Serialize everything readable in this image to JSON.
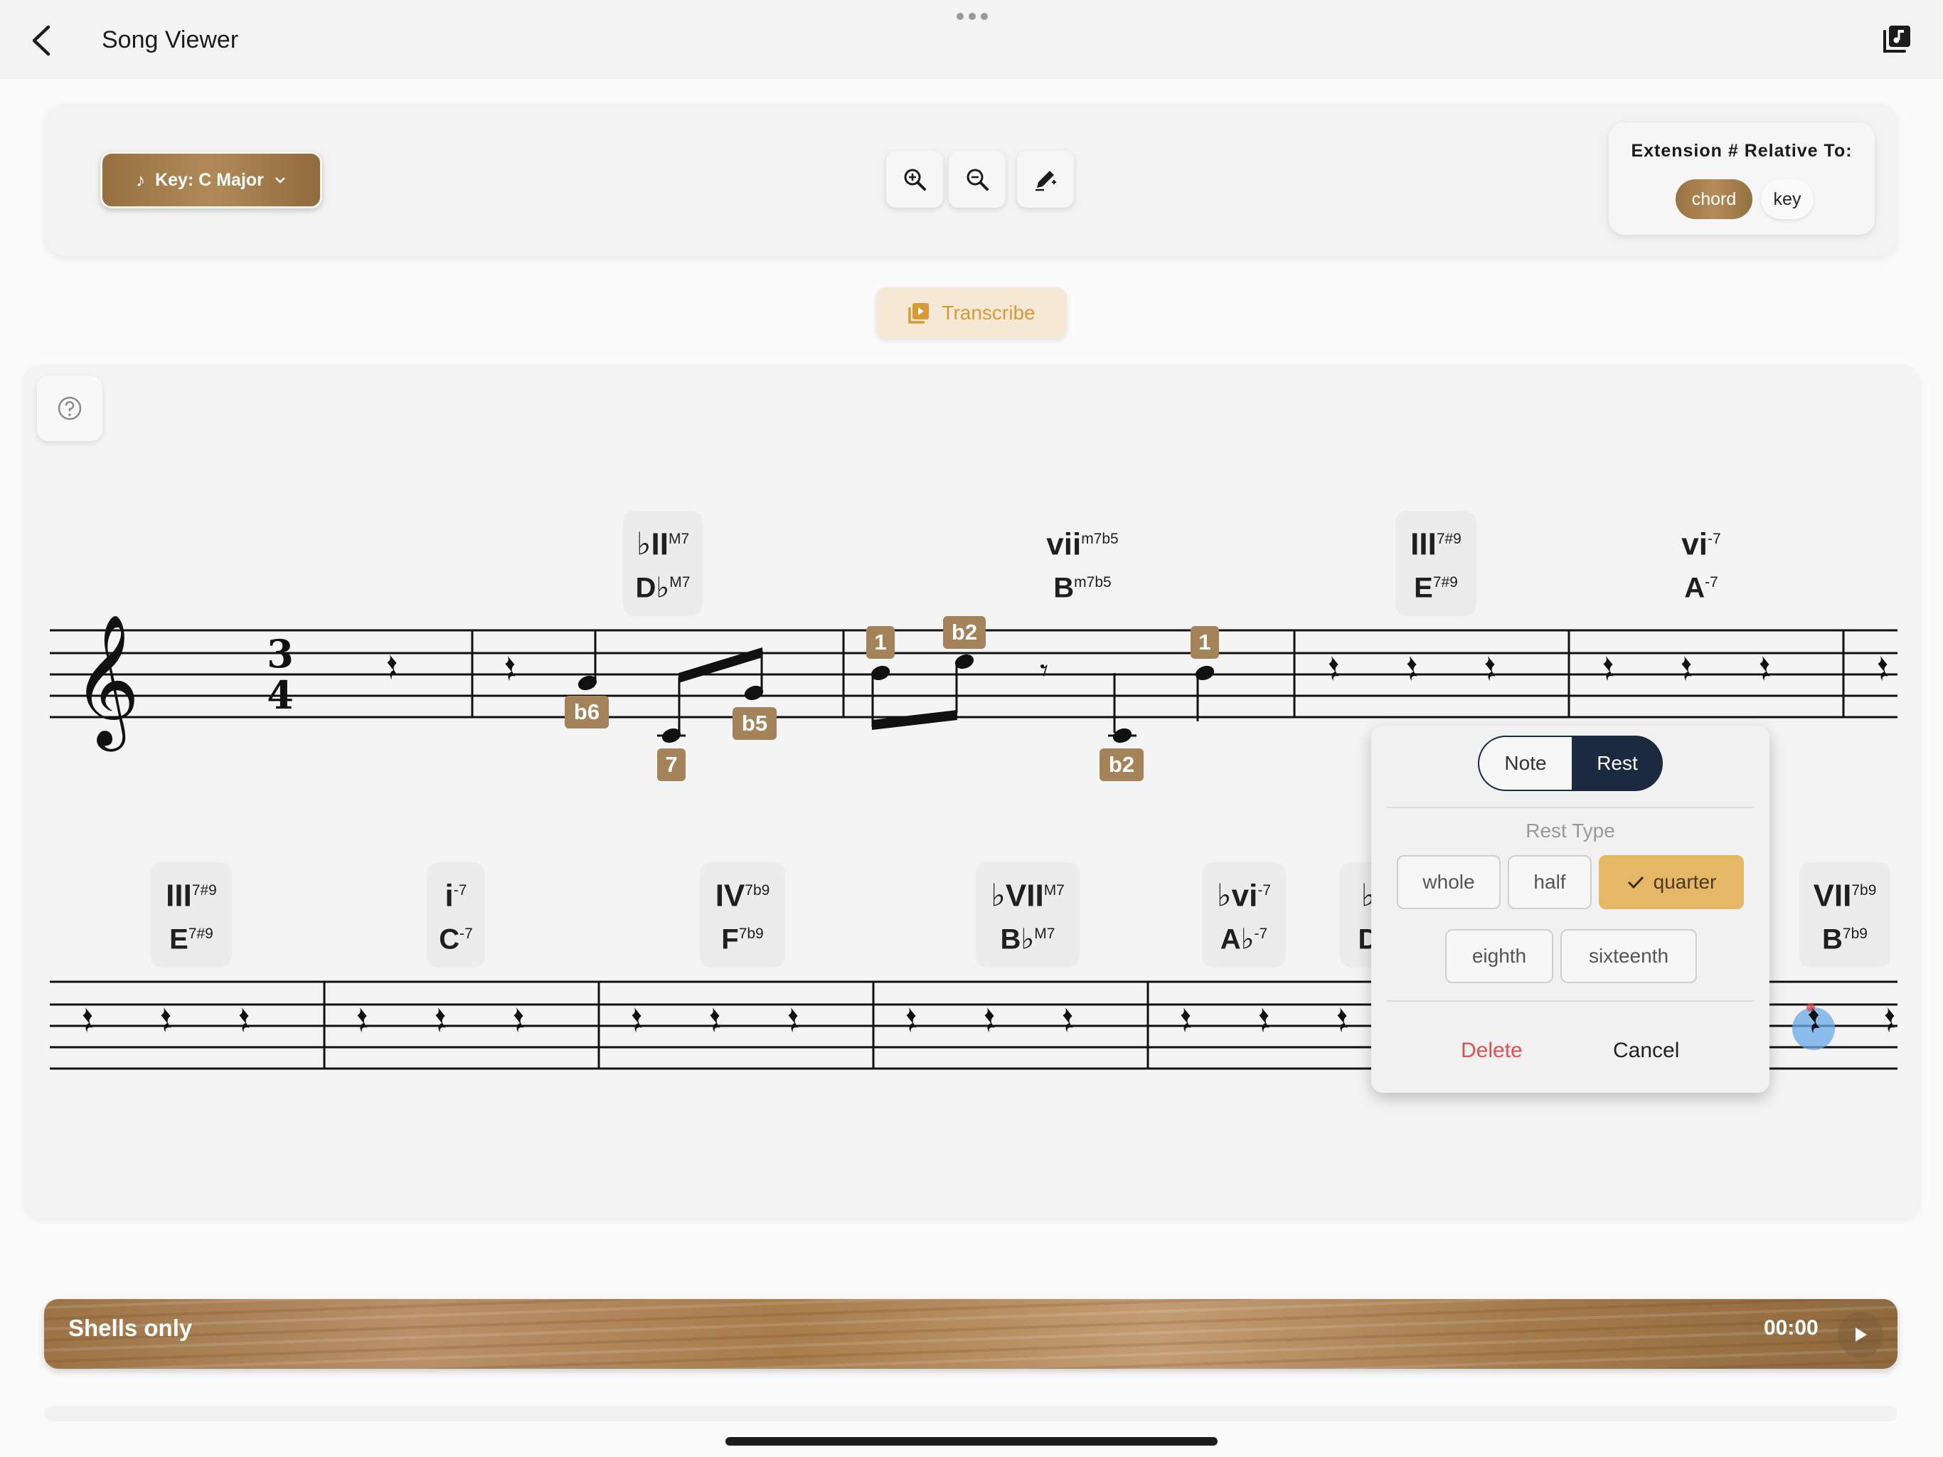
{
  "header": {
    "title": "Song Viewer"
  },
  "toolbar": {
    "key_label": "Key: C Major",
    "extension_label": "Extension # Relative To:",
    "ext_options": [
      "chord",
      "key"
    ],
    "ext_selected": "chord"
  },
  "transcribe_label": "Transcribe",
  "time_signature": {
    "top": "3",
    "bottom": "4"
  },
  "chords_row1": [
    {
      "roman": "♭II",
      "roman_ext": "M7",
      "name": "D♭",
      "name_ext": "M7",
      "boxed": true
    },
    {
      "roman": "vii",
      "roman_ext": "m7b5",
      "name": "B",
      "name_ext": "m7b5",
      "boxed": false
    },
    {
      "roman": "III",
      "roman_ext": "7#9",
      "name": "E",
      "name_ext": "7#9",
      "boxed": true
    },
    {
      "roman": "vi",
      "roman_ext": "-7",
      "name": "A",
      "name_ext": "-7",
      "boxed": false
    }
  ],
  "chords_row2": [
    {
      "roman": "III",
      "roman_ext": "7#9",
      "name": "E",
      "name_ext": "7#9",
      "boxed": true
    },
    {
      "roman": "i",
      "roman_ext": "-7",
      "name": "C",
      "name_ext": "-7",
      "boxed": true
    },
    {
      "roman": "IV",
      "roman_ext": "7b9",
      "name": "F",
      "name_ext": "7b9",
      "boxed": true
    },
    {
      "roman": "♭VII",
      "roman_ext": "M7",
      "name": "B♭",
      "name_ext": "M7",
      "boxed": true
    },
    {
      "roman": "♭vi",
      "roman_ext": "-7",
      "name": "A♭",
      "name_ext": "-7",
      "boxed": true
    },
    {
      "roman": "♭",
      "roman_ext": "",
      "name": "D",
      "name_ext": "",
      "boxed": true
    },
    {
      "roman": "VII",
      "roman_ext": "7b9",
      "name": "B",
      "name_ext": "7b9",
      "boxed": true
    }
  ],
  "interval_tags": [
    "b6",
    "7",
    "b5",
    "1",
    "b2",
    "1",
    "b2",
    "b2"
  ],
  "popup": {
    "tab_note": "Note",
    "tab_rest": "Rest",
    "active_tab": "Rest",
    "rest_type_label": "Rest Type",
    "options": [
      "whole",
      "half",
      "quarter",
      "eighth",
      "sixteenth"
    ],
    "selected": "quarter",
    "delete_label": "Delete",
    "cancel_label": "Cancel"
  },
  "player": {
    "title": "Shells only",
    "time": "00:00"
  },
  "colors": {
    "accent_wood": "#a4835a",
    "dark_navy": "#1b2a40",
    "selected_gold": "#e6b766",
    "delete_red": "#e05050",
    "transcribe_text": "#d89a35"
  }
}
